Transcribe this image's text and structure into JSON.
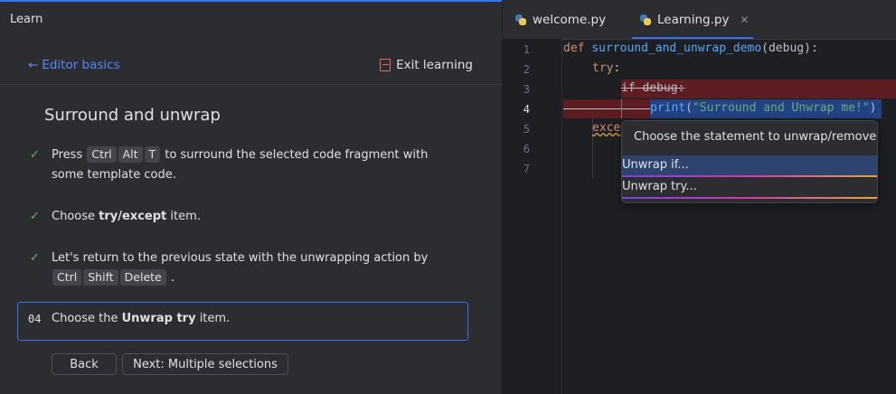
{
  "learn_panel": {
    "header": "Learn",
    "breadcrumb": "Editor basics",
    "exit_label": "Exit learning",
    "lesson_title": "Surround and unwrap",
    "steps": [
      {
        "pre": "Press",
        "keys": [
          "Ctrl",
          "Alt",
          "T"
        ],
        "post": "to surround the selected code fragment with some template code."
      },
      {
        "pre": "Choose",
        "bold": "try/except",
        "post": "item."
      },
      {
        "pre": "Let's return to the previous state with the unwrapping action by",
        "keys": [
          "Ctrl",
          "Shift",
          "Delete"
        ],
        "post": "."
      }
    ],
    "current_step": {
      "number": "04",
      "pre": "Choose the",
      "bold": "Unwrap try",
      "post": "item."
    },
    "back_label": "Back",
    "next_label": "Next: Multiple selections"
  },
  "editor": {
    "tabs": [
      {
        "label": "welcome.py",
        "active": false
      },
      {
        "label": "Learning.py",
        "active": true
      }
    ],
    "line_numbers": [
      "1",
      "2",
      "3",
      "4",
      "5",
      "6",
      "7"
    ],
    "line1": {
      "kw": "def",
      "fn": "surround_and_unwrap_demo",
      "rest": "(debug):"
    },
    "line2": {
      "kw": "try",
      "rest": ":"
    },
    "line3": {
      "text": "if debug:"
    },
    "line4": {
      "fn": "print",
      "open": "(",
      "str": "\"Surround and Unwrap me!\"",
      "close": ")"
    },
    "line5": {
      "kw": "exce"
    },
    "popup": {
      "title": "Choose the statement to unwrap/remove",
      "items": [
        "Unwrap if...",
        "Unwrap try..."
      ]
    }
  },
  "colors": {
    "accent": "#3574f0",
    "check": "#5fb865",
    "delete_highlight": "#5e1d20"
  }
}
